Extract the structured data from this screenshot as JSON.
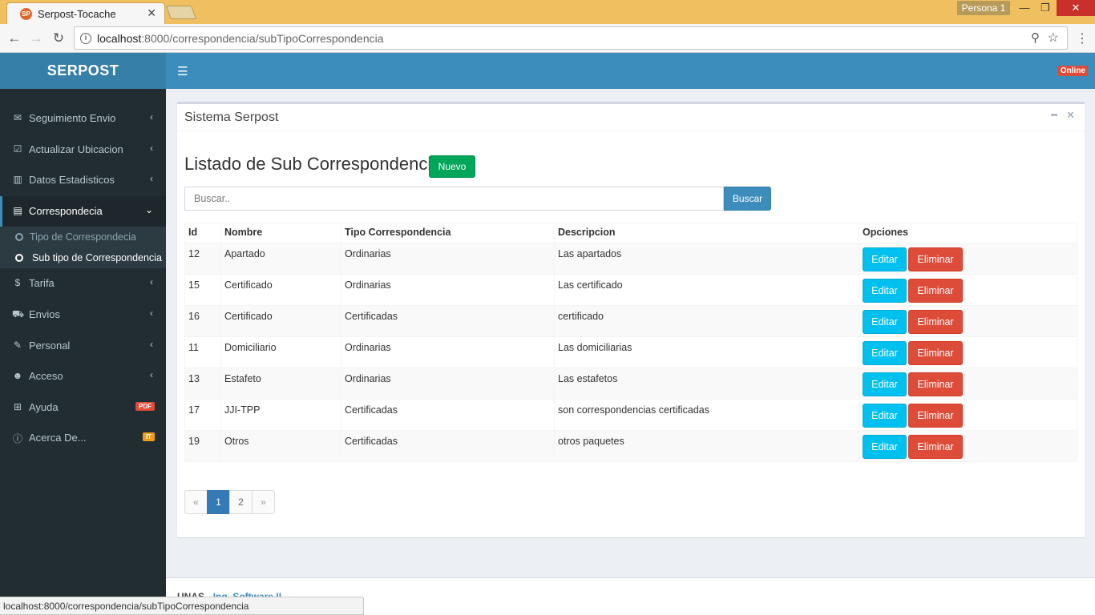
{
  "browser": {
    "tab_title": "Serpost-Tocache",
    "tab_favicon": "SP",
    "profile": "Persona 1",
    "url_host": "localhost",
    "url_rest": ":8000/correspondencia/subTipoCorrespondencia",
    "status_url": "localhost:8000/correspondencia/subTipoCorrespondencia"
  },
  "header": {
    "logo": "SERPOST",
    "online_badge": "Online"
  },
  "sidebar": {
    "items": [
      {
        "label": "Seguimiento Envio",
        "icon": "envelope-icon"
      },
      {
        "label": "Actualizar Ubicacion",
        "icon": "checkbox-icon"
      },
      {
        "label": "Datos Estadisticos",
        "icon": "bar-chart-icon"
      },
      {
        "label": "Correspondecia",
        "icon": "list-alt-icon"
      },
      {
        "label": "Tarifa",
        "icon": "dollar-icon"
      },
      {
        "label": "Envios",
        "icon": "cart-icon"
      },
      {
        "label": "Personal",
        "icon": "edit-icon"
      },
      {
        "label": "Acceso",
        "icon": "users-icon"
      },
      {
        "label": "Ayuda",
        "icon": "plus-square-icon",
        "badge": "PDF",
        "badge_color": "#dd4b39"
      },
      {
        "label": "Acerca De...",
        "icon": "info-circle-icon",
        "badge": "IT",
        "badge_color": "#f39c12"
      }
    ],
    "submenu": [
      {
        "label": "Tipo de Correspondecia"
      },
      {
        "label": "Sub tipo de Correspondencia"
      }
    ]
  },
  "box": {
    "title": "Sistema Serpost"
  },
  "main": {
    "heading": "Listado de Sub Correspondencias",
    "new_button": "Nuevo",
    "search_placeholder": "Buscar..",
    "search_button": "Buscar",
    "columns": [
      "Id",
      "Nombre",
      "Tipo Correspondencia",
      "Descripcion",
      "Opciones"
    ],
    "rows": [
      {
        "id": "12",
        "nombre": "Apartado",
        "tipo": "Ordinarias",
        "descripcion": "Las apartados"
      },
      {
        "id": "15",
        "nombre": "Certificado",
        "tipo": "Ordinarias",
        "descripcion": "Las certificado"
      },
      {
        "id": "16",
        "nombre": "Certificado",
        "tipo": "Certificadas",
        "descripcion": "certificado"
      },
      {
        "id": "11",
        "nombre": "Domiciliario",
        "tipo": "Ordinarias",
        "descripcion": "Las domiciliarias"
      },
      {
        "id": "13",
        "nombre": "Estafeto",
        "tipo": "Ordinarias",
        "descripcion": "Las estafetos"
      },
      {
        "id": "17",
        "nombre": "JJI-TPP",
        "tipo": "Certificadas",
        "descripcion": "son correspondencias certificadas"
      },
      {
        "id": "19",
        "nombre": "Otros",
        "tipo": "Certificadas",
        "descripcion": "otros paquetes"
      }
    ],
    "edit_label": "Editar",
    "delete_label": "Eliminar"
  },
  "pagination": {
    "prev": "«",
    "pages": [
      "1",
      "2"
    ],
    "current": "1",
    "next": "»"
  },
  "footer": {
    "org": "UNAS",
    "link": "Ing. Software II"
  },
  "colors": {
    "header": "#3c8dbc",
    "logo": "#367fa9",
    "sidebar": "#222d32",
    "success": "#00a65a",
    "info": "#00c0ef",
    "danger": "#dd4b39"
  }
}
